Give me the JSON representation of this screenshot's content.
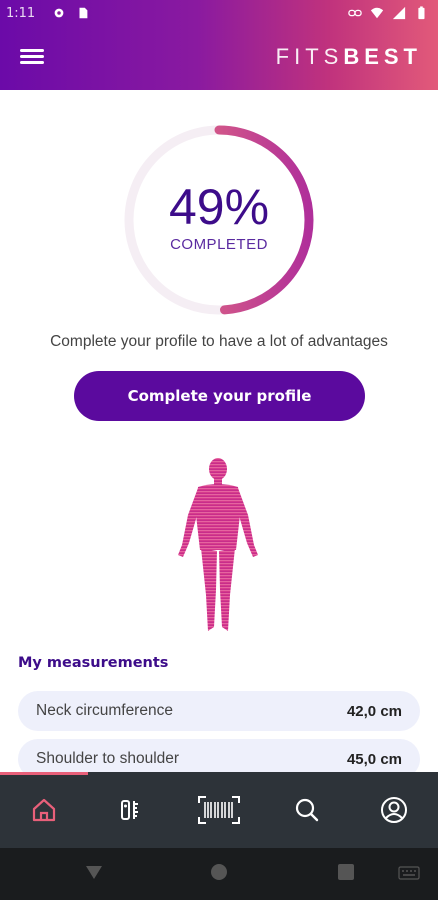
{
  "status_bar": {
    "time": "1:11",
    "icons_left": [
      "settings-icon",
      "sim-icon"
    ],
    "icons_right": [
      "link-icon",
      "wifi-icon",
      "signal-icon",
      "battery-icon"
    ]
  },
  "header": {
    "brand_light": "FITS",
    "brand_bold": "BEST",
    "menu_icon": "hamburger-menu-icon"
  },
  "progress": {
    "percent_text": "49%",
    "percent_value": 49,
    "label": "COMPLETED",
    "track_color": "#f5eef4",
    "arc_start_color": "#b02f9a",
    "arc_end_color": "#f07a7a"
  },
  "prompt_text": "Complete your profile to have a lot of advantages",
  "cta_label": "Complete your profile",
  "measurements": {
    "title": "My measurements",
    "items": [
      {
        "name": "Neck circumference",
        "value": "42,0 cm"
      },
      {
        "name": "Shoulder to shoulder",
        "value": "45,0 cm"
      }
    ]
  },
  "bottom_nav": {
    "items": [
      {
        "name": "home-icon",
        "active": true
      },
      {
        "name": "measure-icon",
        "active": false
      },
      {
        "name": "barcode-scan-icon",
        "active": false
      },
      {
        "name": "search-icon",
        "active": false
      },
      {
        "name": "profile-icon",
        "active": false
      }
    ],
    "active_color": "#e8607a"
  },
  "system_nav": [
    "back-icon",
    "home-circle-icon",
    "recents-icon",
    "keyboard-icon"
  ],
  "colors": {
    "primary": "#5b0a9e",
    "title": "#3d0c8a",
    "nav_bg": "#2d3339"
  }
}
